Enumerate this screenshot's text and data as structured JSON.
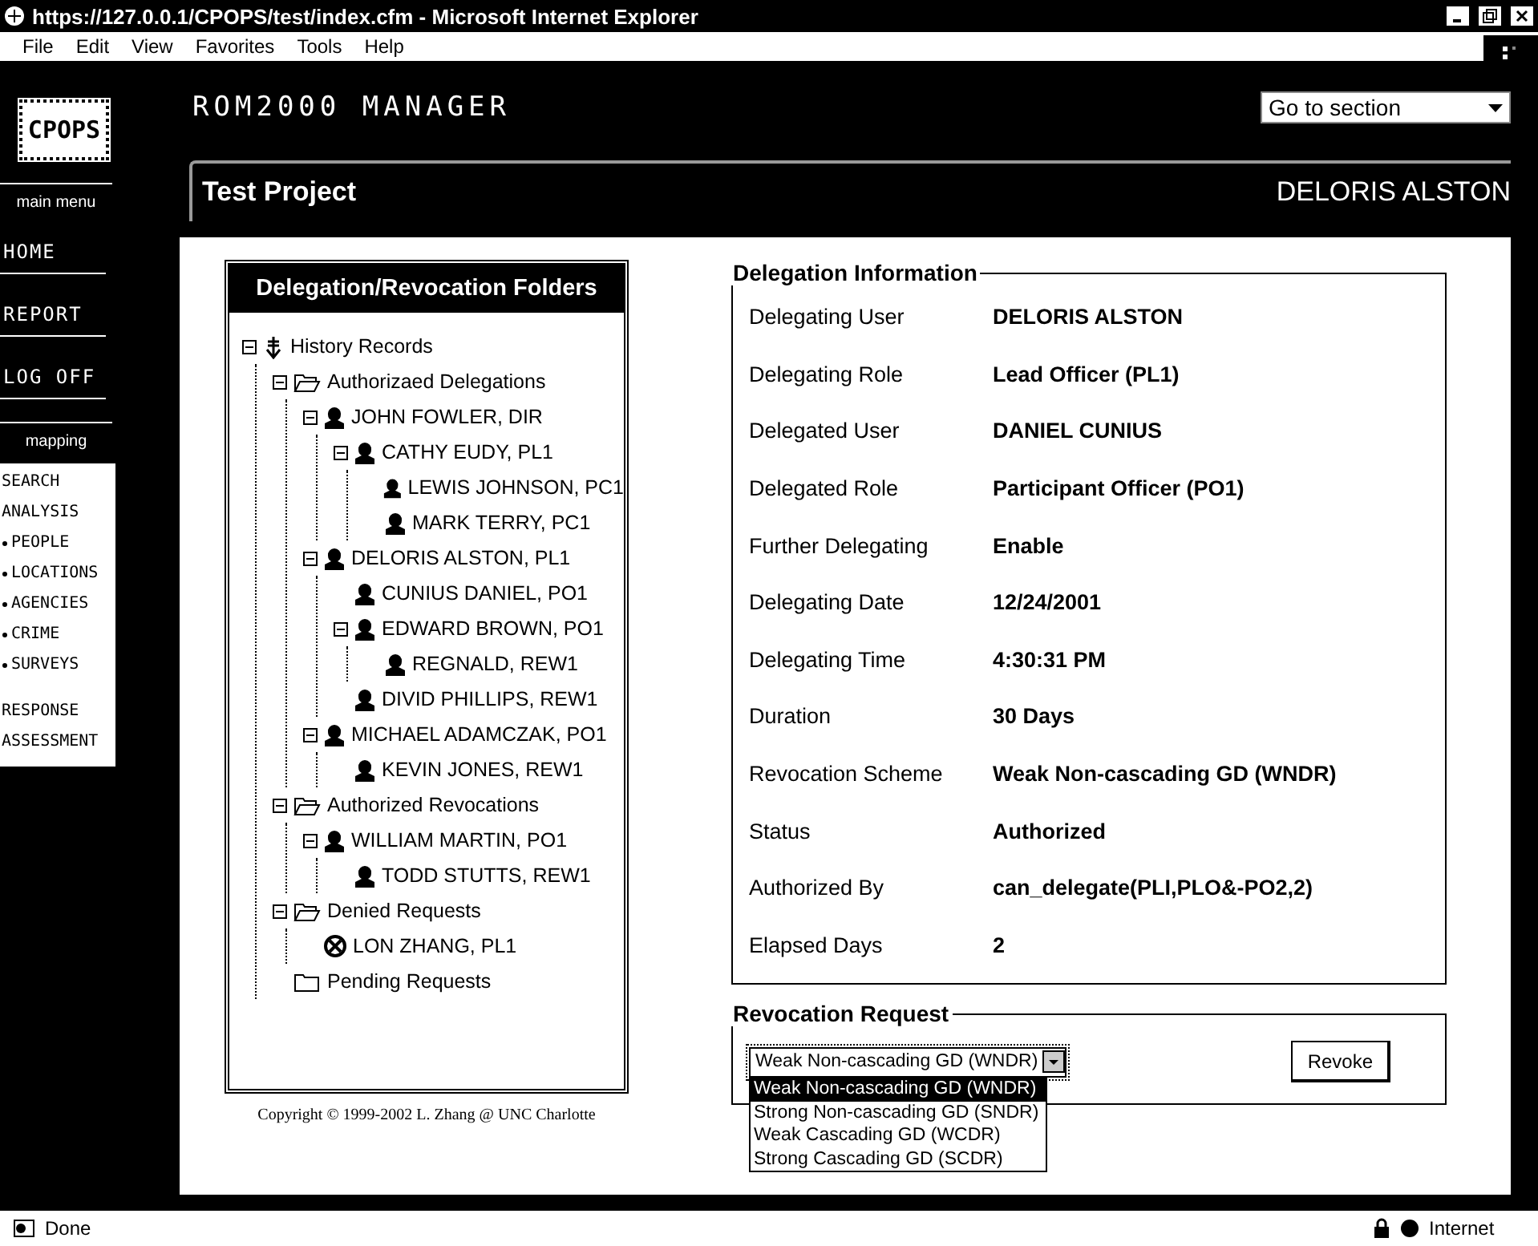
{
  "window": {
    "title": "https://127.0.0.1/CPOPS/test/index.cfm - Microsoft Internet Explorer"
  },
  "menu": [
    "File",
    "Edit",
    "View",
    "Favorites",
    "Tools",
    "Help"
  ],
  "sidebar": {
    "logo": "CPOPS",
    "main_menu_label": "main menu",
    "main_items": [
      "HOME",
      "REPORT",
      "LOG OFF"
    ],
    "mapping_label": "mapping",
    "mapping_items": [
      {
        "label": "SEARCH",
        "bullet": false
      },
      {
        "label": "ANALYSIS",
        "bullet": false
      },
      {
        "label": "PEOPLE",
        "bullet": true
      },
      {
        "label": "LOCATIONS",
        "bullet": true
      },
      {
        "label": "AGENCIES",
        "bullet": true
      },
      {
        "label": "CRIME",
        "bullet": true
      },
      {
        "label": "SURVEYS",
        "bullet": true
      },
      {
        "label": "RESPONSE",
        "bullet": false
      },
      {
        "label": "ASSESSMENT",
        "bullet": false
      }
    ]
  },
  "header": {
    "app_title": "ROM2000 MANAGER",
    "section_select": {
      "value": "Go to section"
    },
    "project": "Test Project",
    "user": "DELORIS ALSTON"
  },
  "folders": {
    "title": "Delegation/Revocation Folders",
    "tree": [
      {
        "label": "History Records",
        "kind": "root",
        "expanded": true,
        "children": [
          {
            "label": "Authorizaed Delegations",
            "kind": "folder",
            "expanded": true,
            "children": [
              {
                "label": "JOHN  FOWLER, DIR",
                "kind": "person",
                "expanded": true,
                "children": [
                  {
                    "label": "CATHY EUDY, PL1",
                    "kind": "person",
                    "expanded": true,
                    "children": [
                      {
                        "label": "LEWIS JOHNSON, PC1",
                        "kind": "person"
                      },
                      {
                        "label": "MARK TERRY,  PC1",
                        "kind": "person"
                      }
                    ]
                  }
                ]
              },
              {
                "label": "DELORIS ALSTON, PL1",
                "kind": "person",
                "expanded": true,
                "children": [
                  {
                    "label": "CUNIUS DANIEL, PO1",
                    "kind": "person"
                  },
                  {
                    "label": "EDWARD BROWN, PO1",
                    "kind": "person",
                    "expanded": true,
                    "children": [
                      {
                        "label": "REGNALD, REW1",
                        "kind": "person"
                      }
                    ]
                  },
                  {
                    "label": "DIVID PHILLIPS, REW1",
                    "kind": "person"
                  }
                ]
              },
              {
                "label": "MICHAEL ADAMCZAK, PO1",
                "kind": "person",
                "expanded": true,
                "children": [
                  {
                    "label": "KEVIN JONES, REW1",
                    "kind": "person"
                  }
                ]
              }
            ]
          },
          {
            "label": "Authorized Revocations",
            "kind": "folder",
            "expanded": true,
            "children": [
              {
                "label": "WILLIAM MARTIN, PO1",
                "kind": "person",
                "expanded": true,
                "children": [
                  {
                    "label": "TODD STUTTS, REW1",
                    "kind": "person"
                  }
                ]
              }
            ]
          },
          {
            "label": "Denied Requests",
            "kind": "folder",
            "expanded": true,
            "children": [
              {
                "label": "LON ZHANG, PL1",
                "kind": "denied"
              }
            ]
          },
          {
            "label": "Pending Requests",
            "kind": "closed-folder"
          }
        ]
      }
    ]
  },
  "copyright": "Copyright © 1999-2002 L. Zhang @ UNC Charlotte",
  "delegation_info": {
    "title": "Delegation Information",
    "rows": [
      {
        "label": "Delegating User",
        "value": "DELORIS ALSTON"
      },
      {
        "label": "Delegating Role",
        "value": "Lead Officer (PL1)"
      },
      {
        "label": "Delegated User",
        "value": "DANIEL CUNIUS"
      },
      {
        "label": "Delegated Role",
        "value": "Participant Officer (PO1)"
      },
      {
        "label": "Further Delegating",
        "value": "Enable"
      },
      {
        "label": "Delegating Date",
        "value": "12/24/2001"
      },
      {
        "label": "Delegating Time",
        "value": "4:30:31 PM"
      },
      {
        "label": "Duration",
        "value": "30 Days"
      },
      {
        "label": "Revocation Scheme",
        "value": "Weak Non-cascading GD (WNDR)"
      },
      {
        "label": "Status",
        "value": "Authorized"
      },
      {
        "label": "Authorized By",
        "value": "can_delegate(PLI,PLO&-PO2,2)"
      },
      {
        "label": "Elapsed Days",
        "value": "2"
      }
    ]
  },
  "revocation_request": {
    "title": "Revocation Request",
    "select": {
      "value": "Weak Non-cascading GD (WNDR)",
      "expanded": true,
      "options": [
        {
          "label": "Weak Non-cascading GD (WNDR)",
          "selected": true
        },
        {
          "label": "Strong Non-cascading GD (SNDR)",
          "selected": false
        },
        {
          "label": "Weak Cascading GD (WCDR)",
          "selected": false
        },
        {
          "label": "Strong Cascading GD (SCDR)",
          "selected": false
        }
      ]
    },
    "button": "Revoke"
  },
  "status_bar": {
    "text": "Done",
    "zone": "Internet"
  }
}
